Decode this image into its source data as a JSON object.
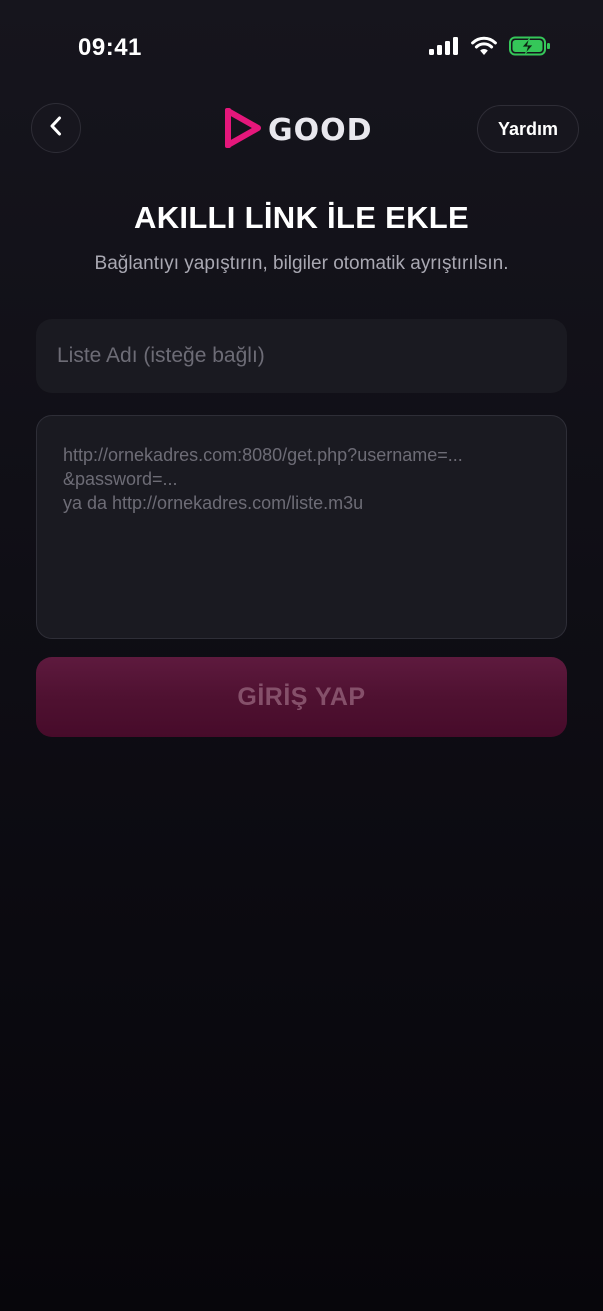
{
  "status_bar": {
    "time": "09:41",
    "icons": [
      "cellular-signal-icon",
      "wifi-icon",
      "battery-charging-icon"
    ]
  },
  "header": {
    "back_icon": "chevron-left-icon",
    "logo_text": "GOOD",
    "help_label": "Yardım"
  },
  "main": {
    "title": "AKILLI LİNK İLE EKLE",
    "subtitle": "Bağlantıyı yapıştırın, bilgiler otomatik ayrıştırılsın.",
    "list_name": {
      "value": "",
      "placeholder": "Liste Adı (isteğe bağlı)"
    },
    "link": {
      "value": "",
      "placeholder": "http://ornekadres.com:8080/get.php?username=...\n&password=...\nya da http://ornekadres.com/liste.m3u"
    },
    "submit_label": "GİRİŞ YAP"
  },
  "colors": {
    "accent": "#e5177b",
    "battery": "#35c759",
    "button_bg": "#4f1131",
    "button_text": "#85506a"
  }
}
